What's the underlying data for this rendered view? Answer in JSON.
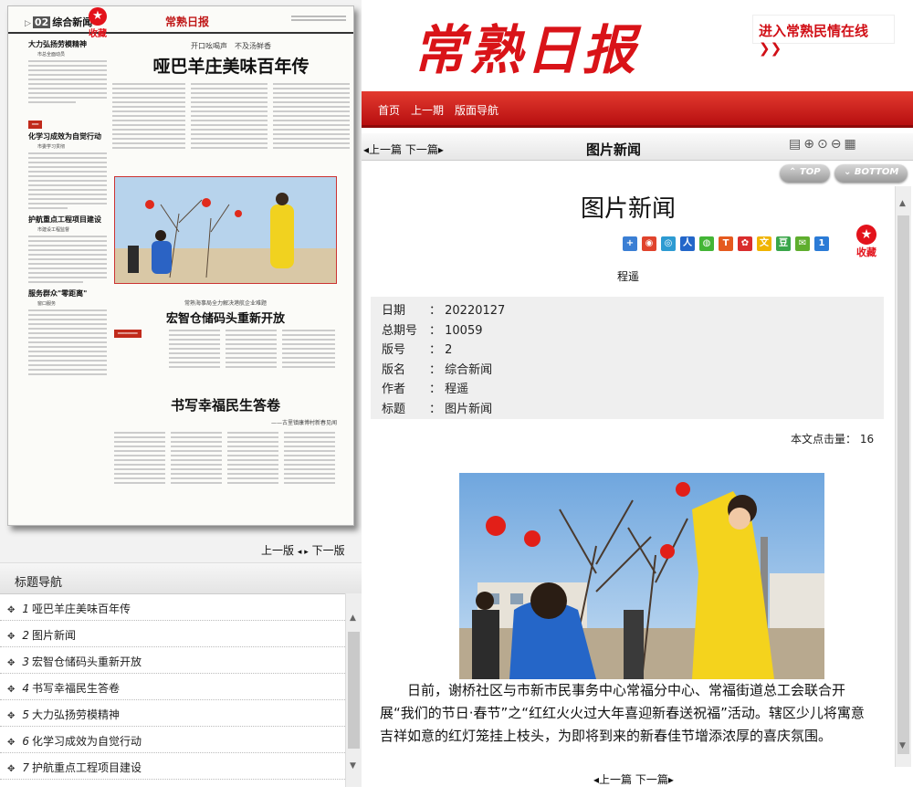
{
  "newspaper": {
    "edition": "02",
    "edition_name": "综合新闻",
    "favorite_label": "收藏",
    "masthead": "常熟日报",
    "kicker": "开口吆喝声　不及汤鲜香",
    "headline": "哑巴羊庄美味百年传",
    "side_items": [
      {
        "head": "大力弘扬劳模精神",
        "sub": "市总全面动员"
      },
      {
        "head": "化学习成效为自觉行动",
        "sub": "市委学习贯彻"
      },
      {
        "head": "护航重点工程项目建设",
        "sub": "市建设工程监督"
      },
      {
        "head": "服务群众\"零距离\"",
        "sub": "窗口服务"
      }
    ],
    "story2_kicker": "常熟海事局全力解决港航企业难题",
    "story2_headline": "宏智仓储码头重新开放",
    "story3_headline": "书写幸福民生答卷",
    "story3_sub": "——古里镇康博村新春见闻"
  },
  "newspaper_pager": {
    "prev": "上一版",
    "next": "下一版"
  },
  "nav": {
    "title": "标题导航",
    "items": [
      {
        "num": "1",
        "label": "哑巴羊庄美味百年传"
      },
      {
        "num": "2",
        "label": "图片新闻"
      },
      {
        "num": "3",
        "label": "宏智仓储码头重新开放"
      },
      {
        "num": "4",
        "label": "书写幸福民生答卷"
      },
      {
        "num": "5",
        "label": "大力弘扬劳模精神"
      },
      {
        "num": "6",
        "label": "化学习成效为自觉行动"
      },
      {
        "num": "7",
        "label": "护航重点工程项目建设"
      }
    ]
  },
  "header": {
    "logo": "常熟日报",
    "minqing_link": "进入常熟民情在线 ❯❯",
    "menu": [
      "首页",
      "上一期",
      "版面导航"
    ]
  },
  "toolbar": {
    "prev_next": "◂上一篇 下一篇▸",
    "title": "图片新闻"
  },
  "scroll_buttons": {
    "top": "TOP",
    "bottom": "BOTTOM"
  },
  "article": {
    "title": "图片新闻",
    "favorite_label": "收藏",
    "author": "程遥",
    "meta": [
      {
        "key": "日期",
        "value": "20220127"
      },
      {
        "key": "总期号",
        "value": "10059"
      },
      {
        "key": "版号",
        "value": "2"
      },
      {
        "key": "版名",
        "value": "综合新闻"
      },
      {
        "key": "作者",
        "value": "程遥"
      },
      {
        "key": "标题",
        "value": "图片新闻"
      }
    ],
    "hits_label": "本文点击量：",
    "hits_value": "16",
    "body": "日前，谢桥社区与市新市民事务中心常福分中心、常福街道总工会联合开展“我们的节日·春节”之“红红火火过大年喜迎新春送祝福”活动。辖区少儿将寓意吉祥如意的红灯笼挂上枝头，为即将到来的新春佳节增添浓厚的喜庆氛围。"
  },
  "bottom_pager": "◂上一篇 下一篇▸",
  "colors": {
    "brand_red": "#d91318",
    "redbar": "#c41e1e"
  }
}
